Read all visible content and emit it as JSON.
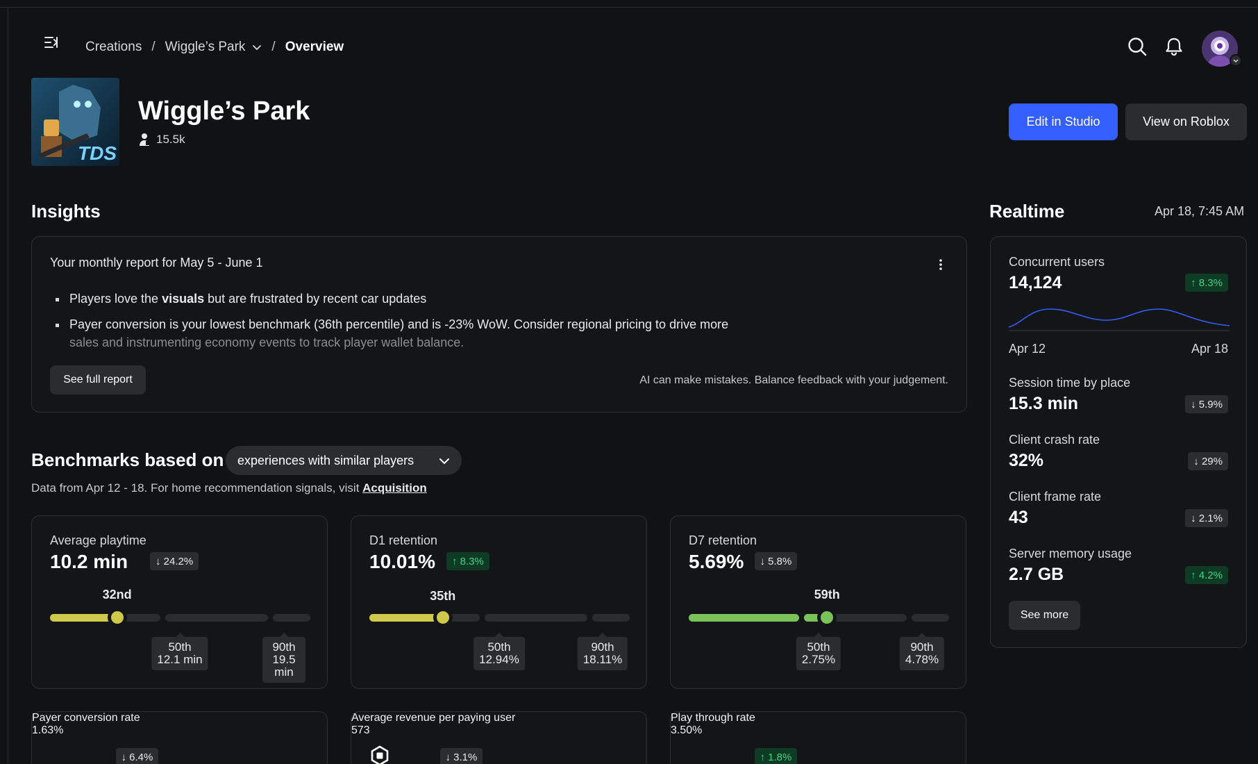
{
  "breadcrumb": {
    "root": "Creations",
    "experience": "Wiggle’s Park",
    "current": "Overview"
  },
  "experience": {
    "title": "Wiggle’s Park",
    "players": "15.5k",
    "thumb_text": "TDS"
  },
  "actions": {
    "edit": "Edit in Studio",
    "view": "View on Roblox"
  },
  "insights": {
    "title": "Insights",
    "report_title": "Your monthly report for May 5 - June 1",
    "bullet1_pre": "Players love the ",
    "bullet1_bold": "visuals",
    "bullet1_post": " but are frustrated by recent car updates",
    "bullet2_line1": "Payer conversion is your lowest benchmark (36th percentile) and is -23% WoW. Consider regional pricing to drive more",
    "bullet2_line2": "sales and instrumenting economy events to track player wallet balance.",
    "see_full": "See full report",
    "disclaimer": "AI can make mistakes. Balance feedback with your judgement."
  },
  "benchmarks": {
    "title": "Benchmarks based on",
    "dropdown": "experiences with similar players",
    "sub_pre": "Data from Apr 12 - 18. For home recommendation signals, visit ",
    "sub_link": "Acquisition",
    "cards": [
      {
        "label": "Average playtime",
        "value": "10.2 min",
        "delta": "24.2%",
        "dir": "down",
        "percentile": "32nd",
        "percentile_value": 32,
        "color": "#cfc84a",
        "p50_label": "50th",
        "p50_value": "12.1 min",
        "p90_label": "90th",
        "p90_value": "19.5 min"
      },
      {
        "label": "D1 retention",
        "value": "10.01%",
        "delta": "8.3%",
        "dir": "up",
        "percentile": "35th",
        "percentile_value": 35,
        "color": "#cfc84a",
        "p50_label": "50th",
        "p50_value": "12.94%",
        "p90_label": "90th",
        "p90_value": "18.11%"
      },
      {
        "label": "D7 retention",
        "value": "5.69%",
        "delta": "5.8%",
        "dir": "down",
        "percentile": "59th",
        "percentile_value": 59,
        "color": "#7ac25a",
        "p50_label": "50th",
        "p50_value": "2.75%",
        "p90_label": "90th",
        "p90_value": "4.78%"
      }
    ],
    "bottom_cards": [
      {
        "label": "Payer conversion rate",
        "value": "1.63%",
        "delta": "6.4%",
        "dir": "down"
      },
      {
        "label": "Average revenue per paying user",
        "value": "573",
        "delta": "3.1%",
        "dir": "down"
      },
      {
        "label": "Play through rate",
        "value": "3.50%",
        "delta": "1.8%",
        "dir": "up"
      }
    ]
  },
  "realtime": {
    "title": "Realtime",
    "date": "Apr 18, 7:45 AM",
    "concurrent": {
      "label": "Concurrent users",
      "value": "14,124",
      "delta": "8.3%",
      "dir": "up"
    },
    "spark_start": "Apr 12",
    "spark_end": "Apr 18",
    "metrics": [
      {
        "label": "Session time by place",
        "value": "15.3 min",
        "delta": "5.9%",
        "dir": "down"
      },
      {
        "label": "Client crash rate",
        "value": "32%",
        "delta": "29%",
        "dir": "down"
      },
      {
        "label": "Client frame rate",
        "value": "43",
        "delta": "2.1%",
        "dir": "down"
      },
      {
        "label": "Server memory usage",
        "value": "2.7 GB",
        "delta": "4.2%",
        "dir": "up"
      }
    ],
    "see_more": "See more"
  },
  "colors": {
    "accent": "#335fff",
    "up": "#3fd18a",
    "up_bg": "#0e3b24"
  }
}
